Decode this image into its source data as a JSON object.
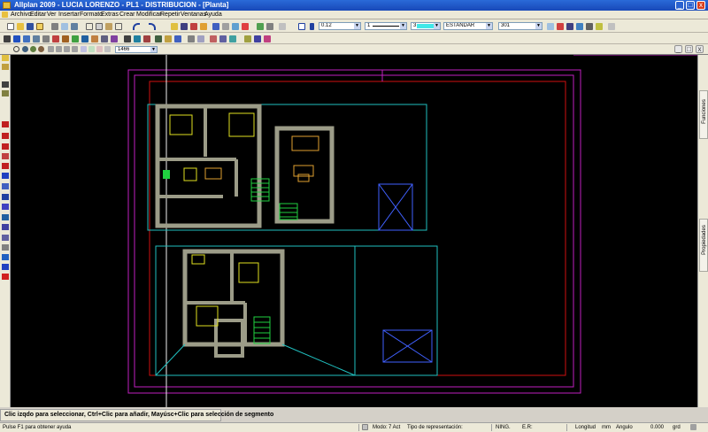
{
  "window": {
    "title": "Allplan 2009 - LUCIA LORENZO - PL1 - DISTRIBUCION - [Planta]",
    "minimize": "_",
    "maximize": "□",
    "close": "x"
  },
  "menu": [
    "Archivo",
    "Editar",
    "Ver",
    "Insertar",
    "Formato",
    "Extras",
    "Crear",
    "Modificar",
    "Repetir",
    "Ventanas",
    "Ayuda"
  ],
  "format_toolbar": {
    "pen_thickness": "0.12",
    "line_type": "1",
    "color_index": "3",
    "color_swatch": "#40e8e8",
    "layer": "ESTANDAR",
    "pattern": "301"
  },
  "view_toolbar": {
    "scale_value": "1466"
  },
  "side_tabs": {
    "functions": "Funciones",
    "properties": "Propiedades"
  },
  "prompt": {
    "text": "Clic izqdo para seleccionar, Ctrl+Clic para añadir, Mayúsc+Clic para selección de segmento"
  },
  "status": {
    "help": "Pulse F1 para obtener ayuda",
    "mode_label": "Modo:",
    "mode_value": "7 Act",
    "representation_label": "Tipo de representación:",
    "ning": "NING.",
    "er": "E.R:",
    "longitud_label": "Longitud",
    "longitud_unit": "mm",
    "angulo_label": "Angulo",
    "angulo_value": "0.000",
    "grados": "grd"
  },
  "colors": {
    "canvas": "#000000",
    "wall": "#9c9c88",
    "magenta": "#c020c0",
    "red": "#d01010",
    "cyan": "#20c0c0",
    "yellow": "#e0e020",
    "green": "#20d040",
    "blue": "#4060ff"
  }
}
